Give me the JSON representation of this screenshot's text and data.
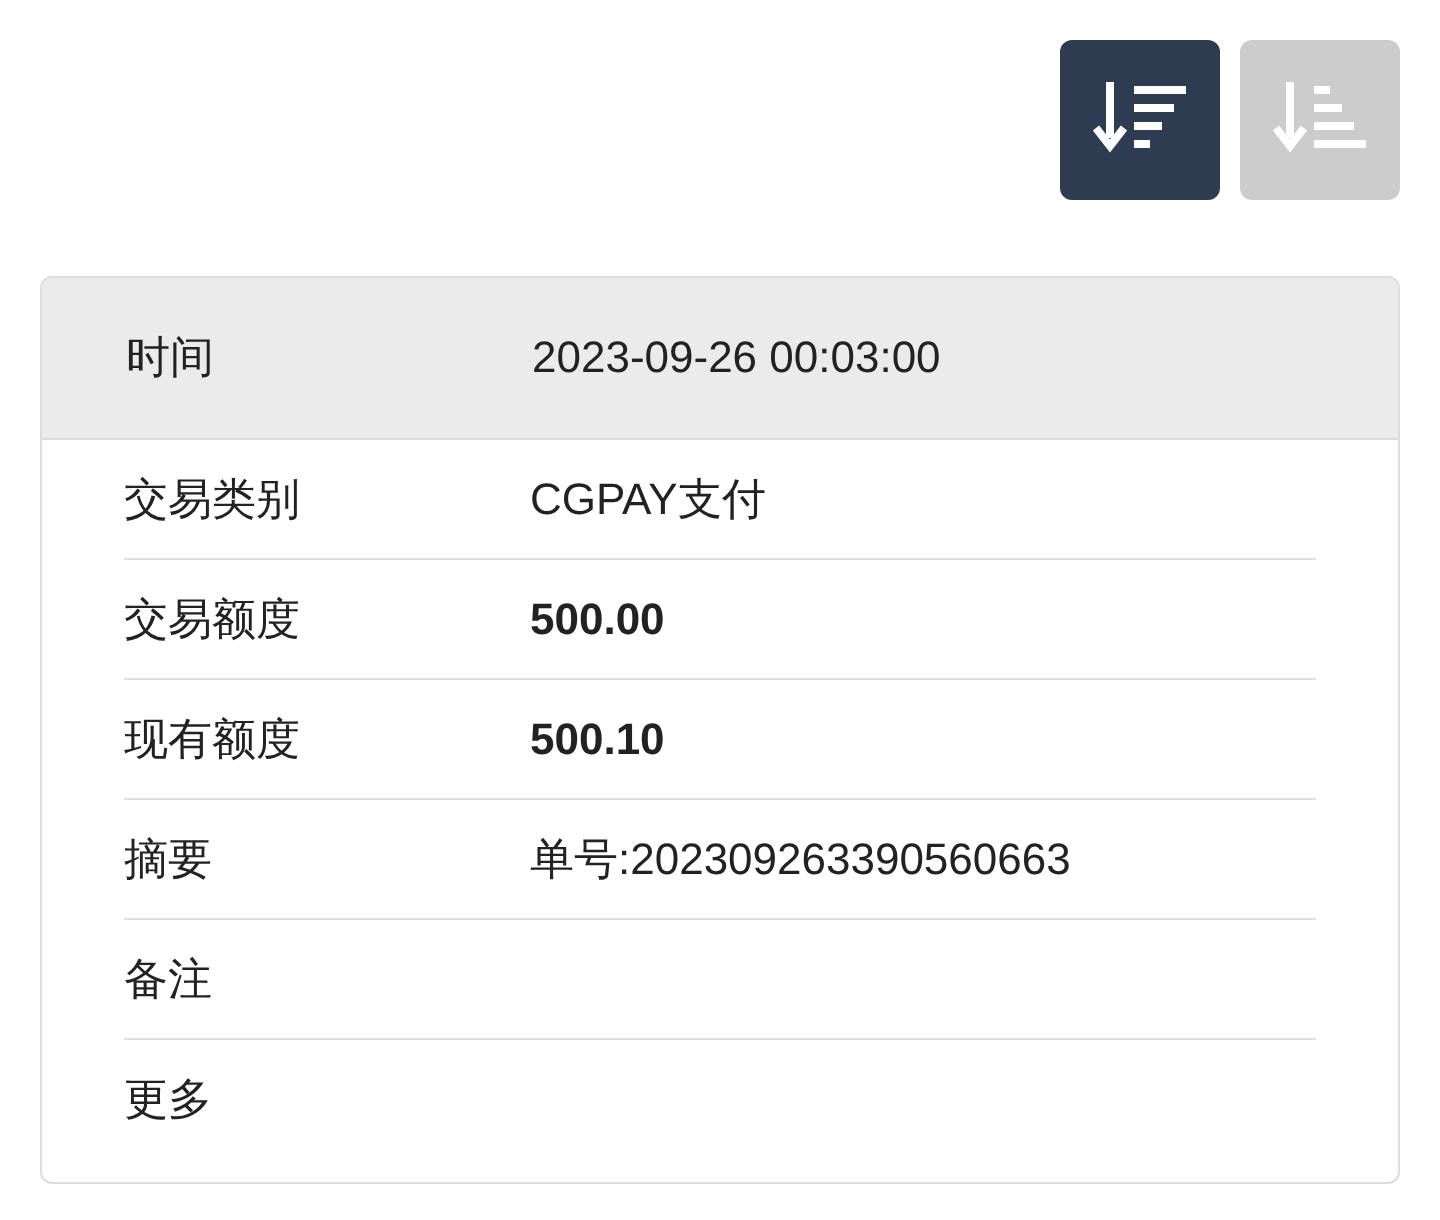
{
  "sort_buttons": [
    {
      "kind": "descending",
      "selected": true
    },
    {
      "kind": "ascending",
      "selected": false
    }
  ],
  "header": {
    "label": "时间",
    "value": "2023-09-26 00:03:00"
  },
  "rows": [
    {
      "label": "交易类别",
      "value": "CGPAY支付",
      "bold": false
    },
    {
      "label": "交易额度",
      "value": "500.00",
      "bold": true
    },
    {
      "label": "现有额度",
      "value": "500.10",
      "bold": true
    },
    {
      "label": "摘要",
      "value": "单号:202309263390560663",
      "bold": false
    },
    {
      "label": "备注"
    },
    {
      "label": "更多"
    }
  ]
}
